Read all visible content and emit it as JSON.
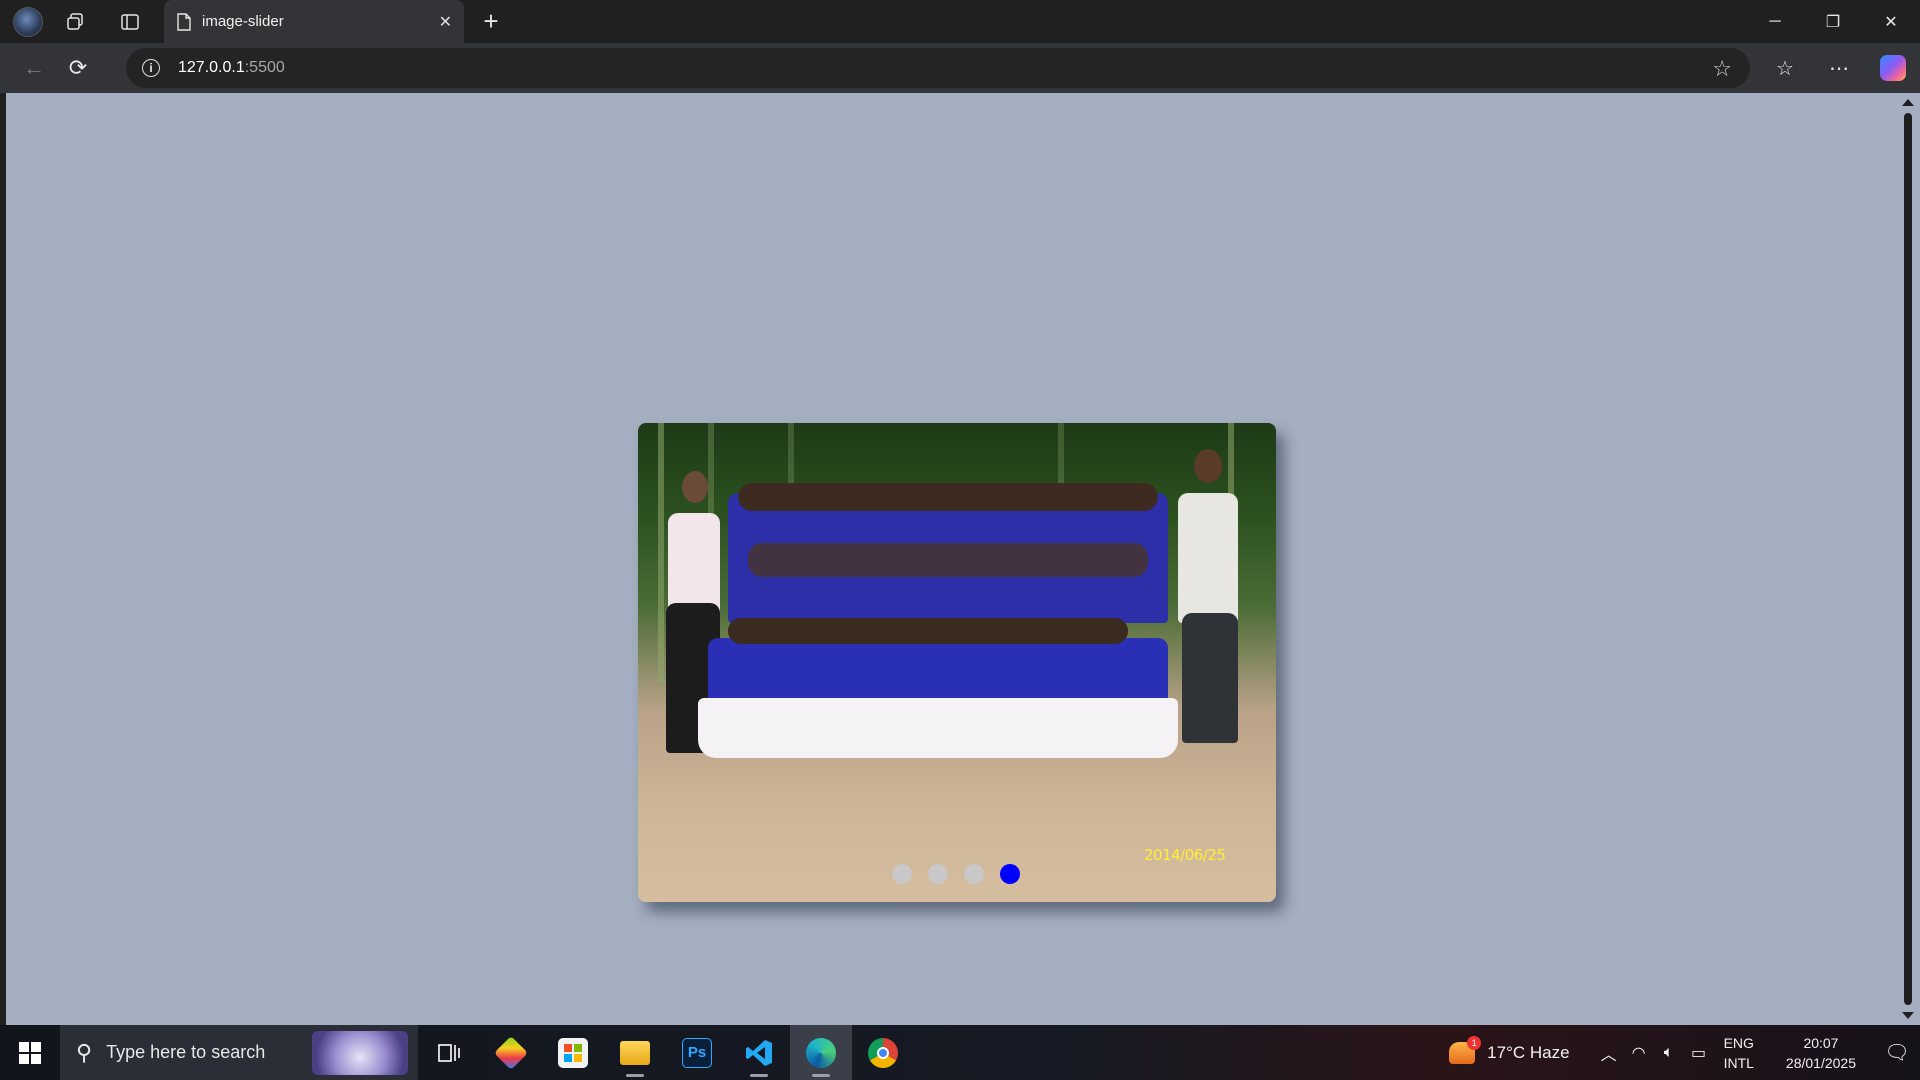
{
  "browser": {
    "tab_title": "image-slider",
    "url_host": "127.0.0.1",
    "url_port": ":5500",
    "icons": [
      "profile-icon",
      "workspaces-icon",
      "tab-actions-icon",
      "page-icon",
      "close-icon",
      "new-tab-icon",
      "back-icon",
      "refresh-icon",
      "info-icon",
      "star-icon",
      "favorites-icon",
      "more-icon",
      "copilot-icon"
    ]
  },
  "slider": {
    "date_stamp": "2014/06/25",
    "dots": [
      {
        "active": false
      },
      {
        "active": false
      },
      {
        "active": false
      },
      {
        "active": true
      }
    ],
    "active_color": "#0000ff",
    "inactive_color": "#c8c8c8",
    "page_background": "#a4afc1"
  },
  "taskbar": {
    "search_placeholder": "Type here to search",
    "apps": [
      {
        "name": "task-view",
        "glyph": "⊞"
      },
      {
        "name": "bluestacks",
        "glyph": ""
      },
      {
        "name": "microsoft-store",
        "glyph": ""
      },
      {
        "name": "file-explorer",
        "glyph": ""
      },
      {
        "name": "photoshop",
        "glyph": "Ps"
      },
      {
        "name": "vscode",
        "glyph": ""
      },
      {
        "name": "edge",
        "glyph": ""
      },
      {
        "name": "chrome",
        "glyph": ""
      }
    ],
    "weather_badge": "1",
    "weather": "17°C Haze",
    "lang_top": "ENG",
    "lang_bottom": "INTL",
    "time": "20:07",
    "date": "28/01/2025"
  }
}
